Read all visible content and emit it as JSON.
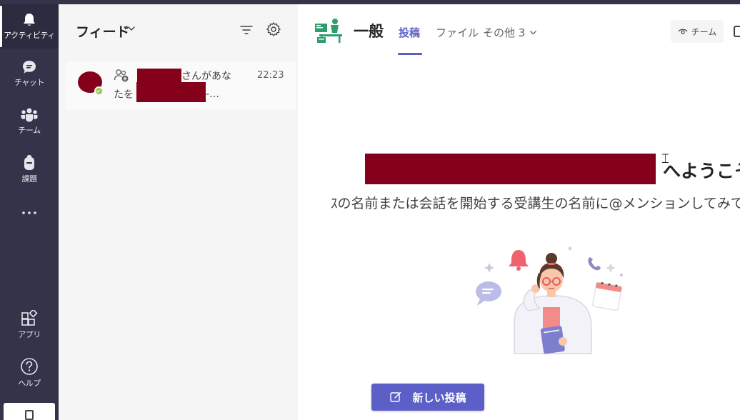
{
  "rail": {
    "items": [
      {
        "label": "アクティビティ",
        "icon": "bell-icon",
        "active": true
      },
      {
        "label": "チャット",
        "icon": "chat-icon"
      },
      {
        "label": "チーム",
        "icon": "teams-icon"
      },
      {
        "label": "課題",
        "icon": "backpack-icon"
      },
      {
        "label": "",
        "icon": "more-icon"
      },
      {
        "label": "アプリ",
        "icon": "apps-icon"
      },
      {
        "label": "ヘルプ",
        "icon": "help-icon"
      }
    ]
  },
  "feed": {
    "title": "フィード",
    "items": [
      {
        "line1_suffix": "さんがあな",
        "line2_prefix": "たを",
        "line2_suffix": "-…",
        "time": "22:23"
      }
    ]
  },
  "channel": {
    "title": "一般",
    "tabs": [
      {
        "label": "投稿",
        "active": true
      },
      {
        "label": "ファイル"
      },
      {
        "label": "その他 3"
      }
    ],
    "team_button": "チーム"
  },
  "welcome": {
    "title_suffix": "へようこそ",
    "subtitle": "ｽの名前または会話を開始する受講生の名前に@メンションしてみて"
  },
  "new_post_button": "新しい投稿",
  "colors": {
    "rail_bg": "#33344a",
    "accent": "#5b5fc7",
    "redaction": "#85001a",
    "status_available": "#92c353"
  }
}
